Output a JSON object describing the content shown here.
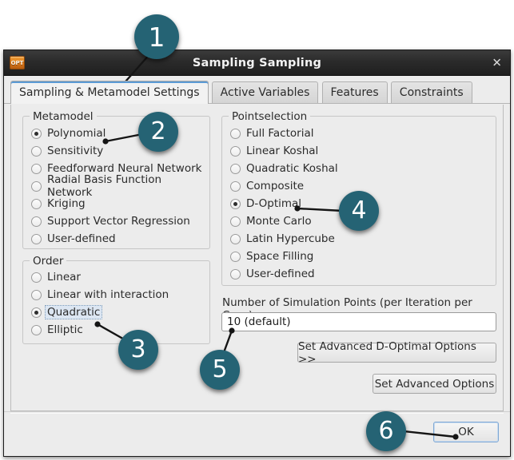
{
  "window": {
    "title": "Sampling Sampling",
    "app_icon": "OPT",
    "icon_label": "OPT",
    "close_label": "✕"
  },
  "tabs": [
    {
      "label": "Sampling & Metamodel Settings",
      "active": true
    },
    {
      "label": "Active Variables",
      "active": false
    },
    {
      "label": "Features",
      "active": false
    },
    {
      "label": "Constraints",
      "active": false
    }
  ],
  "metamodel": {
    "legend": "Metamodel",
    "options": [
      {
        "label": "Polynomial",
        "checked": true
      },
      {
        "label": "Sensitivity",
        "checked": false
      },
      {
        "label": "Feedforward Neural Network",
        "checked": false
      },
      {
        "label": "Radial Basis Function Network",
        "checked": false
      },
      {
        "label": "Kriging",
        "checked": false
      },
      {
        "label": "Support Vector Regression",
        "checked": false
      },
      {
        "label": "User-defined",
        "checked": false
      }
    ]
  },
  "order": {
    "legend": "Order",
    "options": [
      {
        "label": "Linear",
        "checked": false
      },
      {
        "label": "Linear with interaction",
        "checked": false
      },
      {
        "label": "Quadratic",
        "checked": true,
        "focused": true
      },
      {
        "label": "Elliptic",
        "checked": false
      }
    ]
  },
  "pointselection": {
    "legend": "Pointselection",
    "options": [
      {
        "label": "Full Factorial",
        "checked": false
      },
      {
        "label": "Linear Koshal",
        "checked": false
      },
      {
        "label": "Quadratic Koshal",
        "checked": false
      },
      {
        "label": "Composite",
        "checked": false
      },
      {
        "label": "D-Optimal",
        "checked": true
      },
      {
        "label": "Monte Carlo",
        "checked": false
      },
      {
        "label": "Latin Hypercube",
        "checked": false
      },
      {
        "label": "Space Filling",
        "checked": false
      },
      {
        "label": "User-defined",
        "checked": false
      }
    ]
  },
  "simulation_points": {
    "label": "Number of Simulation Points (per Iteration per Case)",
    "value": "10 (default)",
    "placeholder": ""
  },
  "buttons": {
    "advanced_doptimal": "Set Advanced D-Optimal Options >>",
    "advanced_options": "Set Advanced Options",
    "ok": "OK"
  },
  "callouts": [
    {
      "number": "1"
    },
    {
      "number": "2"
    },
    {
      "number": "3"
    },
    {
      "number": "4"
    },
    {
      "number": "5"
    },
    {
      "number": "6"
    }
  ],
  "colors": {
    "badge": "#256374",
    "tab_accent": "#5b9bd5",
    "focus_border": "#7fa8d4",
    "window_bg": "#ececec"
  }
}
